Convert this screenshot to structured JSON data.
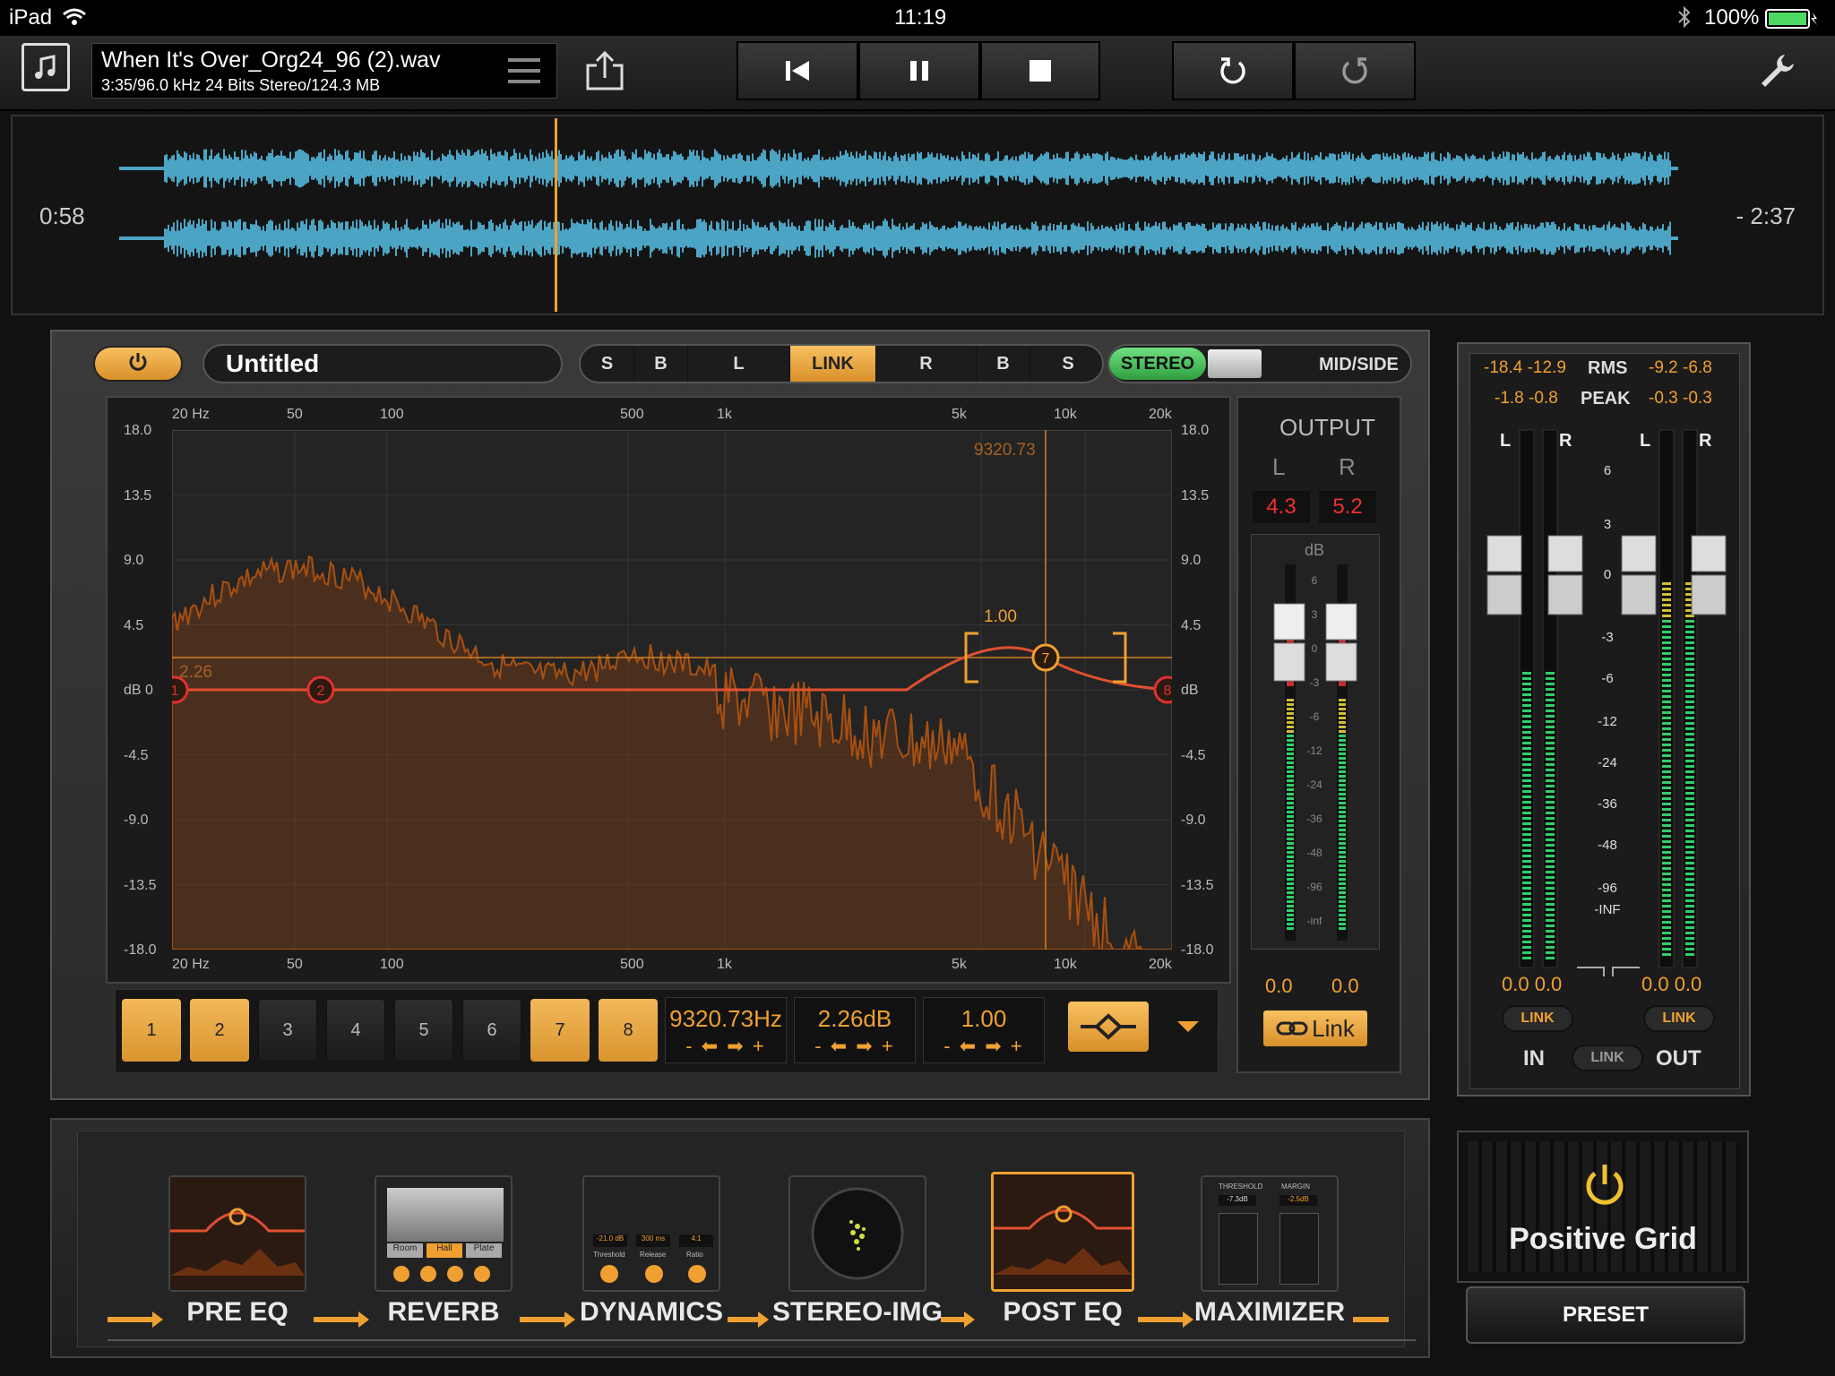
{
  "status": {
    "device": "iPad",
    "time": "11:19",
    "battery": "100%"
  },
  "file": {
    "name": "When It's Over_Org24_96 (2).wav",
    "details": "3:35/96.0 kHz 24 Bits Stereo/124.3 MB"
  },
  "transport": {
    "icons": [
      "skip-back-icon",
      "pause-icon",
      "stop-icon",
      "undo-icon",
      "redo-icon"
    ]
  },
  "waveform": {
    "elapsed": "0:58",
    "remaining": "- 2:37",
    "playhead_fraction": 0.27
  },
  "eq": {
    "preset_name": "Untitled",
    "channel_buttons": [
      "S",
      "B",
      "L",
      "LINK",
      "R",
      "B",
      "S"
    ],
    "stereo_label": "STEREO",
    "midside_label": "MID/SIDE",
    "freq_ticks_top": [
      "20 Hz",
      "50",
      "100",
      "500",
      "1k",
      "5k",
      "10k",
      "20k"
    ],
    "freq_ticks_bottom": [
      "20 Hz",
      "50",
      "100",
      "500",
      "1k",
      "5k",
      "10k",
      "20k"
    ],
    "db_ticks_left": [
      "18.0",
      "13.5",
      "9.0",
      "4.5",
      "dB 0",
      "-4.5",
      "-9.0",
      "-13.5",
      "-18.0"
    ],
    "db_ticks_right": [
      "18.0",
      "13.5",
      "9.0",
      "4.5",
      "dB",
      "-4.5",
      "-9.0",
      "-13.5",
      "-18.0"
    ],
    "cursor_freq": "9320.73",
    "gain_marker": "2.26",
    "q_marker": "1.00",
    "nodes": [
      "1",
      "2",
      "7",
      "8"
    ],
    "bands": [
      {
        "label": "1",
        "active": true
      },
      {
        "label": "2",
        "active": true
      },
      {
        "label": "3",
        "active": false
      },
      {
        "label": "4",
        "active": false
      },
      {
        "label": "5",
        "active": false
      },
      {
        "label": "6",
        "active": false
      },
      {
        "label": "7",
        "active": true
      },
      {
        "label": "8",
        "active": true
      }
    ],
    "freq_value": "9320.73Hz",
    "gain_value": "2.26dB",
    "q_value": "1.00",
    "arrows": "- ⬅ ➡ +"
  },
  "output": {
    "title": "OUTPUT",
    "l": "L",
    "r": "R",
    "l_value": "4.3",
    "r_value": "5.2",
    "db_label": "dB",
    "scale": [
      "6",
      "3",
      "0",
      "-3",
      "-6",
      "-12",
      "-24",
      "-36",
      "-48",
      "-96",
      "-inf"
    ],
    "l_fader": "0.0",
    "r_fader": "0.0",
    "link": "Link"
  },
  "meters": {
    "rms_label": "RMS",
    "peak_label": "PEAK",
    "in_rms": "-18.4 -12.9",
    "out_rms": "-9.2 -6.8",
    "in_peak": "-1.8 -0.8",
    "out_peak": "-0.3 -0.3",
    "scale": [
      "6",
      "3",
      "0",
      "-3",
      "-6",
      "-12",
      "-24",
      "-36",
      "-48",
      "-96",
      "-INF"
    ],
    "in_values": "0.0  0.0",
    "out_values": "0.0  0.0",
    "link": "LINK",
    "in_label": "IN",
    "out_label": "OUT",
    "l": "L",
    "r": "R"
  },
  "chain": [
    {
      "label": "PRE EQ",
      "selected": false
    },
    {
      "label": "REVERB",
      "selected": false
    },
    {
      "label": "DYNAMICS",
      "selected": false
    },
    {
      "label": "STEREO-IMG",
      "selected": false
    },
    {
      "label": "POST EQ",
      "selected": true
    },
    {
      "label": "MAXIMIZER",
      "selected": false
    }
  ],
  "reverb_thumb": [
    "Room",
    "Hall",
    "Plate"
  ],
  "dynamics_thumb": [
    "-21.0 dB",
    "300 ms",
    "4:1",
    "Threshold",
    "Release",
    "Ratio"
  ],
  "maximizer_thumb": [
    "THRESHOLD",
    "MARGIN",
    "-7.3dB",
    "-2.5dB"
  ],
  "brand": "Positive Grid",
  "preset_button": "PRESET",
  "colors": {
    "accent": "#f0a030",
    "wave": "#5bc8f0",
    "meter_green": "#2fcf6a"
  }
}
